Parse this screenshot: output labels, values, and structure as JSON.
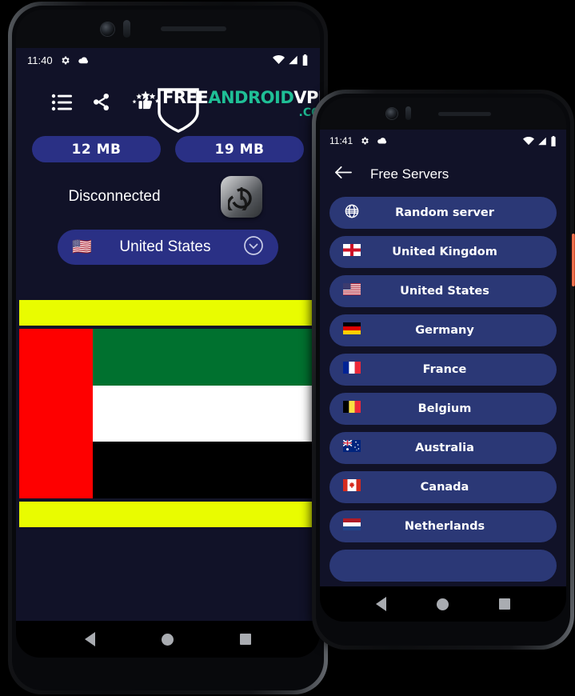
{
  "phone1": {
    "status_bar": {
      "time": "11:40",
      "left_icons": [
        "gear-icon",
        "cloud-icon"
      ],
      "right_icons": [
        "wifi-icon",
        "signal-icon",
        "battery-icon"
      ]
    },
    "header": {
      "icons": [
        "list-icon",
        "share-icon",
        "rate-thumbsup-icon"
      ],
      "logo": {
        "part1": "FREE",
        "part2": "ANDROID",
        "part3": "VPN",
        "part4": ".COM",
        "white": "#ffffff",
        "teal": "#1fbf96"
      }
    },
    "stats": {
      "download": "12 MB",
      "upload": "19 MB"
    },
    "connection": {
      "status": "Disconnected",
      "power_label": "power-toggle"
    },
    "selected_server": {
      "flag": "🇺🇸",
      "name": "United States",
      "chevron": "chevron-down-icon"
    },
    "banner": {
      "top_band_color": "#e9fc00",
      "bottom_band_color": "#e9fc00",
      "flag_colors": [
        "#fe0000",
        "#00712f",
        "#ffffff",
        "#000000"
      ]
    },
    "nav": [
      "back-button",
      "home-button",
      "recents-button"
    ]
  },
  "phone2": {
    "status_bar": {
      "time": "11:41",
      "left_icons": [
        "gear-icon",
        "cloud-icon"
      ],
      "right_icons": [
        "wifi-icon",
        "signal-icon",
        "battery-icon"
      ]
    },
    "appbar": {
      "back": "back-arrow-icon",
      "title": "Free Servers"
    },
    "servers": [
      {
        "flag": "globe",
        "name": "Random server"
      },
      {
        "flag": "🏴󠁧󠁢󠁥󠁮󠁧󠁿",
        "name": "United Kingdom"
      },
      {
        "flag": "🇺🇸",
        "name": "United States"
      },
      {
        "flag": "🇩🇪",
        "name": "Germany"
      },
      {
        "flag": "🇫🇷",
        "name": "France"
      },
      {
        "flag": "🇧🇪",
        "name": "Belgium"
      },
      {
        "flag": "🇦🇺",
        "name": "Australia"
      },
      {
        "flag": "🇨🇦",
        "name": "Canada"
      },
      {
        "flag": "🇳🇱",
        "name": "Netherlands"
      },
      {
        "flag": "",
        "name": ""
      }
    ],
    "nav": [
      "back-button",
      "home-button",
      "recents-button"
    ],
    "side_button_color": "#d4492a"
  },
  "theme": {
    "background": "#111228",
    "pill": "#2a3085",
    "list_item": "#2b3876",
    "text": "#ffffff"
  }
}
